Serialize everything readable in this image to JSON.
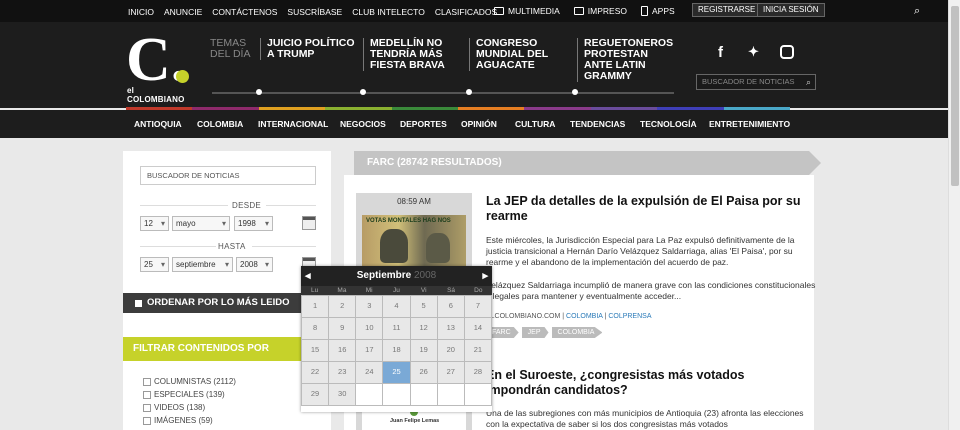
{
  "topbar": {
    "nav": [
      "INICIO",
      "ANUNCIE",
      "CONTÁCTENOS",
      "SUSCRÍBASE",
      "CLUB INTELECTO",
      "CLASIFICADOS"
    ],
    "multimedia": "MULTIMEDIA",
    "impreso": "IMPRESO",
    "apps": "APPS",
    "register": "REGISTRARSE",
    "login": "INICIA SESIÓN"
  },
  "logo": {
    "letter": "C.",
    "name": "el COLOMBIANO"
  },
  "temas": "TEMAS DEL DÍA",
  "topics": [
    "JUICIO POLÍTICO A TRUMP",
    "MEDELLÍN NO TENDRÍA MÁS FIESTA BRAVA",
    "CONGRESO MUNDIAL DEL AGUACATE",
    "REGUETONEROS PROTESTAN ANTE LATIN GRAMMY"
  ],
  "header_search_placeholder": "BUSCADOR DE NOTICIAS",
  "colorbar": [
    "#c0392b",
    "#8e2a6b",
    "#e0a020",
    "#8ab030",
    "#3a8a3a",
    "#e67e22",
    "#8a3a8a",
    "#6a4c9c",
    "#3f3fb8",
    "#4aa8c8"
  ],
  "categories": [
    "ANTIOQUIA",
    "COLOMBIA",
    "INTERNACIONAL",
    "NEGOCIOS",
    "DEPORTES",
    "OPINIÓN",
    "CULTURA",
    "TENDENCIAS",
    "TECNOLOGÍA",
    "ENTRETENIMIENTO"
  ],
  "filter": {
    "search_placeholder": "BUSCADOR DE NOTICIAS",
    "desde_label": "DESDE",
    "hasta_label": "HASTA",
    "desde": {
      "day": "12",
      "month": "mayo",
      "year": "1998"
    },
    "hasta": {
      "day": "25",
      "month": "septiembre",
      "year": "2008"
    },
    "order_label": "ORDENAR POR LO MÁS LEIDO",
    "filter_label": "FILTRAR CONTENIDOS POR",
    "checkboxes": [
      "COLUMNISTAS (2112)",
      "ESPECIALES (139)",
      "VIDEOS (138)",
      "IMÁGENES (59)"
    ]
  },
  "results_header": "FARC (28742 RESULTADOS)",
  "articles": [
    {
      "time": "08:59 AM",
      "title": "La JEP da detalles de la expulsión de El Paisa por su rearme",
      "p1": "Este miércoles, la Jurisdicción Especial para La Paz expulsó definitivamente de la justicia transicional a Hernán Darío Velázquez Saldarriaga, alias 'El Paisa', por su rearme y el abandono de la implementación del acuerdo de paz.",
      "p2": "Velázquez Saldarriaga incumplió de manera grave con las condiciones constitucionales y legales para mantener y eventualmente acceder...",
      "source": "ELCOLOMBIANO.COM",
      "section": "COLOMBIA",
      "agency": "COLPRENSA",
      "tags": [
        "FARC",
        "JEP",
        "COLOMBIA"
      ],
      "thumb_text": "VOTAS MONTALES HAG NOS"
    },
    {
      "title": "En el Suroeste, ¿congresistas más votados impondrán candidatos?",
      "p1": "Una de las subregiones con más municipios de Antioquia (23) afronta las elecciones con la expectativa de saber si los dos congresistas más votados",
      "thumb_text": "Juan Felipe Lemas"
    }
  ],
  "calendar": {
    "month": "Septiembre",
    "year": "2008",
    "dow": [
      "Lu",
      "Ma",
      "Mi",
      "Ju",
      "Vi",
      "Sá",
      "Do"
    ],
    "days": [
      "1",
      "2",
      "3",
      "4",
      "5",
      "6",
      "7",
      "8",
      "9",
      "10",
      "11",
      "12",
      "13",
      "14",
      "15",
      "16",
      "17",
      "18",
      "19",
      "20",
      "21",
      "22",
      "23",
      "24",
      "25",
      "26",
      "27",
      "28",
      "29",
      "30",
      "",
      "",
      "",
      "",
      ""
    ],
    "selected": "25"
  }
}
